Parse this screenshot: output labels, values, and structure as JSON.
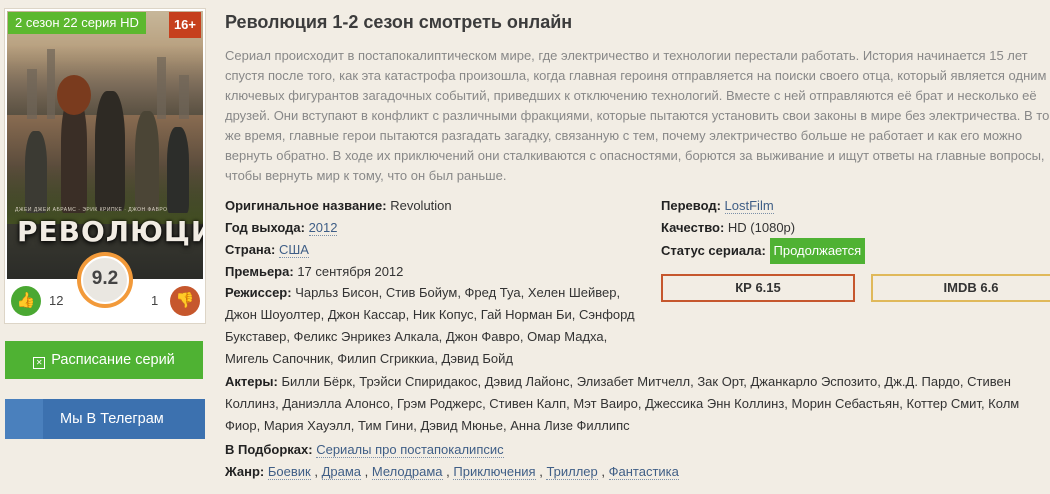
{
  "poster": {
    "episode_badge": "2 сезон 22 серия HD",
    "age_badge": "16+",
    "logo_text": "РЕВОЛЮЦИЯ",
    "credits_text": "ДЖЕЙ ДЖЕЙ АБРАМС · ЭРИК КРИПКЕ · ДЖОН ФАВРО",
    "rating": "9.2",
    "likes": "12",
    "dislikes": "1"
  },
  "buttons": {
    "schedule": "Расписание серий",
    "telegram": "Мы В Телеграм"
  },
  "title": "Революция 1-2 сезон смотреть онлайн",
  "description": "Сериал происходит в постапокалиптическом мире, где электричество и технологии перестали работать. История начинается 15 лет спустя после того, как эта катастрофа произошла, когда главная героиня отправляется на поиски своего отца, который является одним из ключевых фигурантов загадочных событий, приведших к отключению технологий. Вместе с ней отправляются её брат и несколько её друзей. Они вступают в конфликт с различными фракциями, которые пытаются установить свои законы в мире без электричества. В то же время, главные герои пытаются разгадать загадку, связанную с тем, почему электричество больше не работает и как его можно вернуть обратно. В ходе их приключений они сталкиваются с опасностями, борются за выживание и ищут ответы на главные вопросы, чтобы вернуть мир к тому, что он был раньше.",
  "info": {
    "original_label": "Оригинальное название:",
    "original_value": "Revolution",
    "year_label": "Год выхода:",
    "year_value": "2012",
    "country_label": "Страна:",
    "country_value": "США",
    "premiere_label": "Премьера:",
    "premiere_value": "17 сентября 2012",
    "director_label": "Режиссер:",
    "director_value": "Чарльз Бисон, Стив Бойум, Фред Туа, Хелен Шейвер, Джон Шоуолтер, Джон Кассар, Ник Копус, Гай Норман Би, Сэнфорд Букставер, Феликс Энрикез Алкала, Джон Фавро, Омар Мадха, Мигель Сапочник, Филип Сгриккиа, Дэвид Бойд",
    "actors_label": "Актеры:",
    "actors_value": "Билли Бёрк, Трэйси Спиридакос, Дэвид Лайонс, Элизабет Митчелл, Зак Орт, Джанкарло Эспозито, Дж.Д. Пардо, Стивен Коллинз, Даниэлла Алонсо, Грэм Роджерс, Стивен Калп, Мэт Ваиро, Джессика Энн Коллинз, Морин Себастьян, Коттер Смит, Колм Фиор, Мария Хауэлл, Тим Гини, Дэвид Мюнье, Анна Лизе Филлипс",
    "collections_label": "В Подборках:",
    "collections_value": "Сериалы про постапокалипсис",
    "genre_label": "Жанр:",
    "genres": [
      "Боевик",
      "Драма",
      "Мелодрама",
      "Приключения",
      "Триллер",
      "Фантастика"
    ],
    "translation_label": "Перевод:",
    "translation_value": "LostFilm",
    "quality_label": "Качество:",
    "quality_value": "HD (1080p)",
    "status_label": "Статус сериала:",
    "status_value": "Продолжается"
  },
  "ratings": {
    "kp": "КР 6.15",
    "imdb": "IMDB 6.6"
  },
  "colors": {
    "accent_green": "#4fb233",
    "telegram_blue": "#3c71af",
    "age_red": "#c6401d",
    "kp_border": "#c6572d",
    "imdb_border": "#e0b95a"
  }
}
